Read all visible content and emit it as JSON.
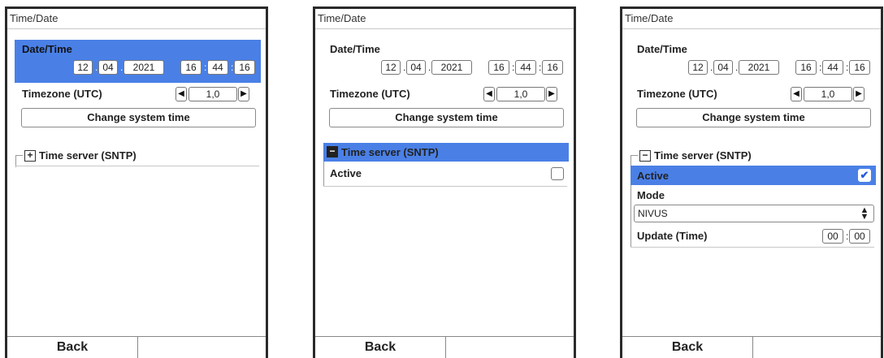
{
  "screens": [
    {
      "title": "Time/Date",
      "date_time_label": "Date/Time",
      "day": "12",
      "month": "04",
      "year": "2021",
      "hour": "16",
      "minute": "44",
      "second": "16",
      "timezone_label": "Timezone (UTC)",
      "timezone_value": "1,0",
      "change_button": "Change system time",
      "sntp_label": "Time server (SNTP)",
      "sntp_toggle": "+",
      "back": "Back"
    },
    {
      "title": "Time/Date",
      "date_time_label": "Date/Time",
      "day": "12",
      "month": "04",
      "year": "2021",
      "hour": "16",
      "minute": "44",
      "second": "16",
      "timezone_label": "Timezone (UTC)",
      "timezone_value": "1,0",
      "change_button": "Change system time",
      "sntp_label": "Time server (SNTP)",
      "sntp_toggle": "−",
      "active_label": "Active",
      "back": "Back"
    },
    {
      "title": "Time/Date",
      "date_time_label": "Date/Time",
      "day": "12",
      "month": "04",
      "year": "2021",
      "hour": "16",
      "minute": "44",
      "second": "16",
      "timezone_label": "Timezone (UTC)",
      "timezone_value": "1,0",
      "change_button": "Change system time",
      "sntp_label": "Time server (SNTP)",
      "sntp_toggle": "−",
      "active_label": "Active",
      "active_check": "✔",
      "mode_label": "Mode",
      "mode_value": "NIVUS",
      "update_label": "Update (Time)",
      "update_hh": "00",
      "update_mm": "00",
      "back": "Back"
    }
  ],
  "colors": {
    "highlight": "#4a80e6"
  },
  "icons": [
    "left-arrow-icon",
    "right-arrow-icon",
    "plus-icon",
    "minus-icon",
    "check-icon",
    "spinner-icon"
  ]
}
